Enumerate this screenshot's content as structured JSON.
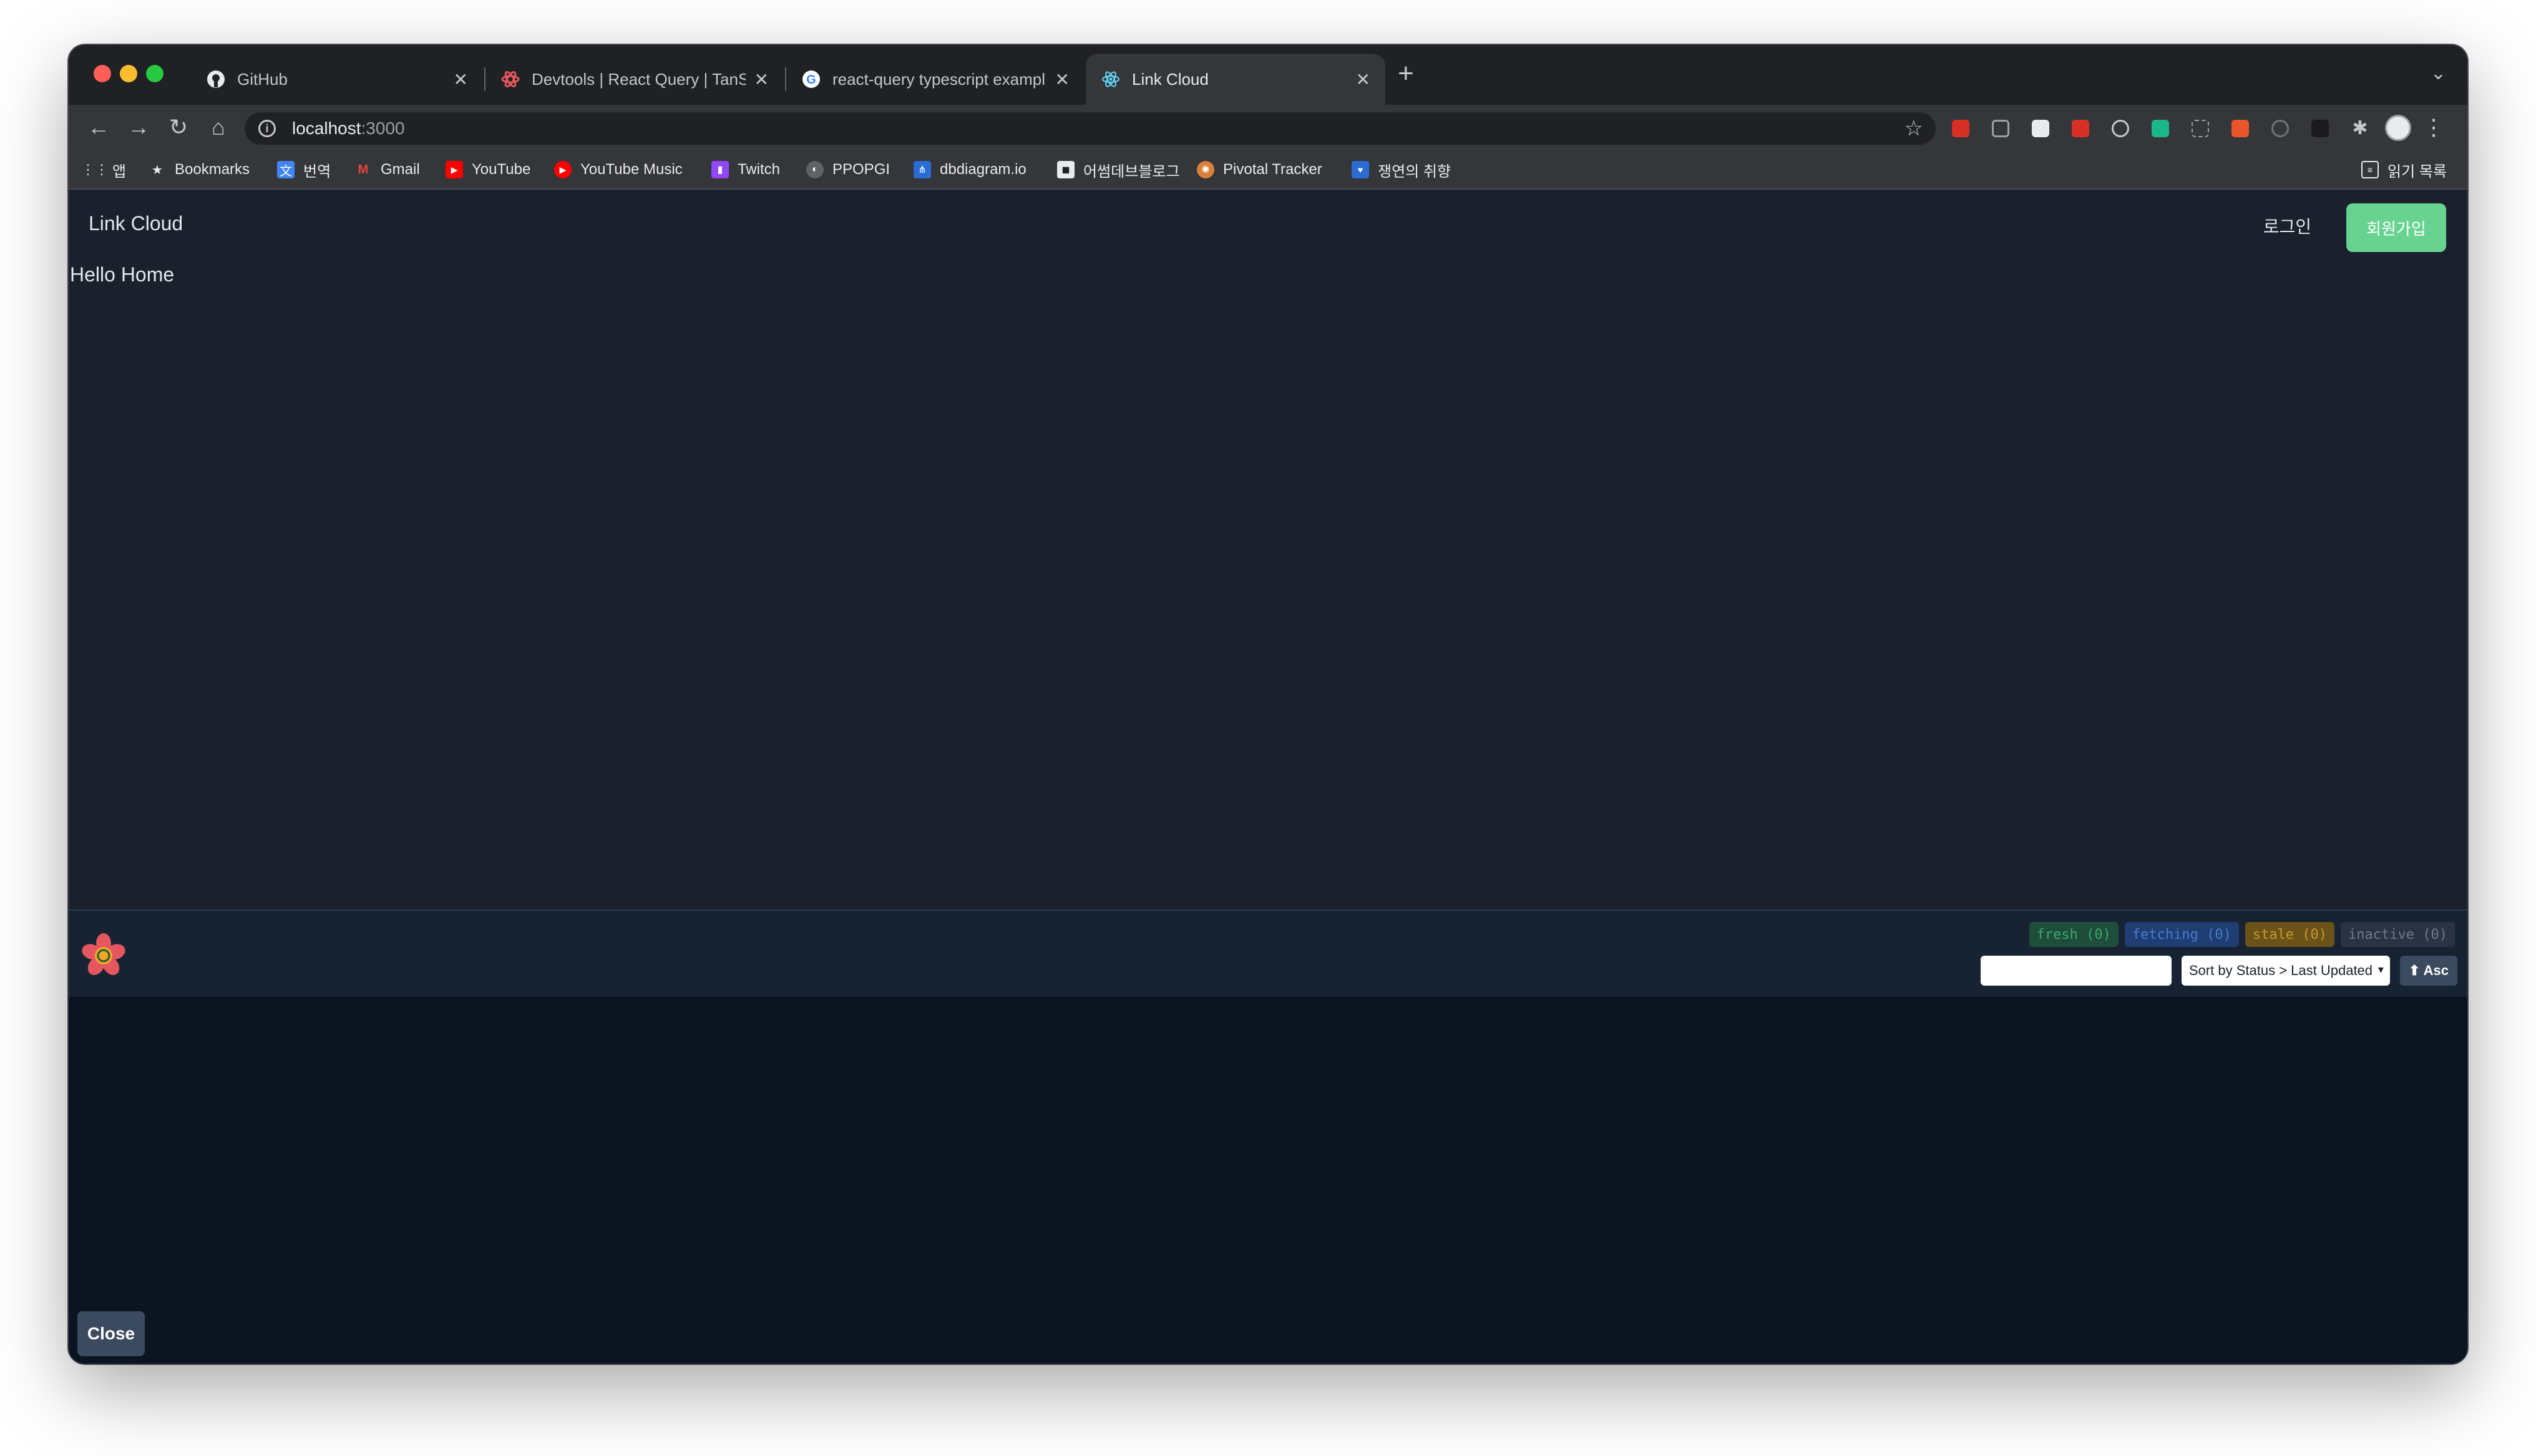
{
  "tabs": [
    {
      "title": "GitHub",
      "icon": "github-icon"
    },
    {
      "title": "Devtools | React Query | TanSt",
      "icon": "react-query-icon"
    },
    {
      "title": "react-query typescript exampl",
      "icon": "google-icon"
    },
    {
      "title": "Link Cloud",
      "icon": "react-icon",
      "active": true
    }
  ],
  "toolbar": {
    "url_host": "localhost",
    "url_port": ":3000"
  },
  "bookmarks": {
    "apps": "앱",
    "items": [
      "Bookmarks",
      "번역",
      "Gmail",
      "YouTube",
      "YouTube Music",
      "Twitch",
      "PPOPGI",
      "dbdiagram.io",
      "어썸데브블로그",
      "Pivotal Tracker",
      "쟁연의 취향"
    ],
    "reading_list": "읽기 목록"
  },
  "app": {
    "brand": "Link Cloud",
    "login": "로그인",
    "signup": "회원가입",
    "hello": "Hello Home"
  },
  "devtools": {
    "badges": {
      "fresh": "fresh (0)",
      "fetching": "fetching (0)",
      "stale": "stale (0)",
      "inactive": "inactive (0)"
    },
    "filter_placeholder": "",
    "sort_label": "Sort by Status > Last Updated",
    "asc_label": "⬆ Asc",
    "close_label": "Close"
  },
  "colors": {
    "page_bg": "#1a202c",
    "signup_bg": "#68d391",
    "devtools_bg": "#0b1521"
  }
}
